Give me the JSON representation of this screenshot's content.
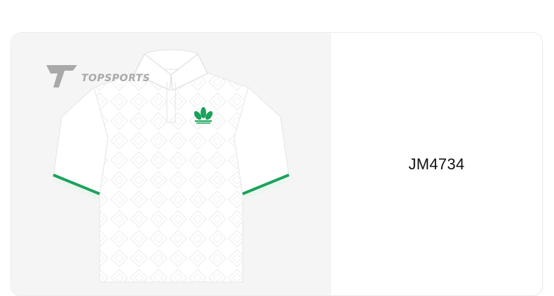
{
  "product": {
    "sku": "JM4734",
    "image_alt": "White polo shirt with green trefoil logo and green striped sleeve trim",
    "watermark_text": "TOPSPORTS"
  },
  "colors": {
    "image_background": "#f5f5f5",
    "card_background": "#ffffff",
    "shirt": "#ffffff",
    "accent_green": "#1aa35b",
    "watermark": "#a9a9a9"
  }
}
